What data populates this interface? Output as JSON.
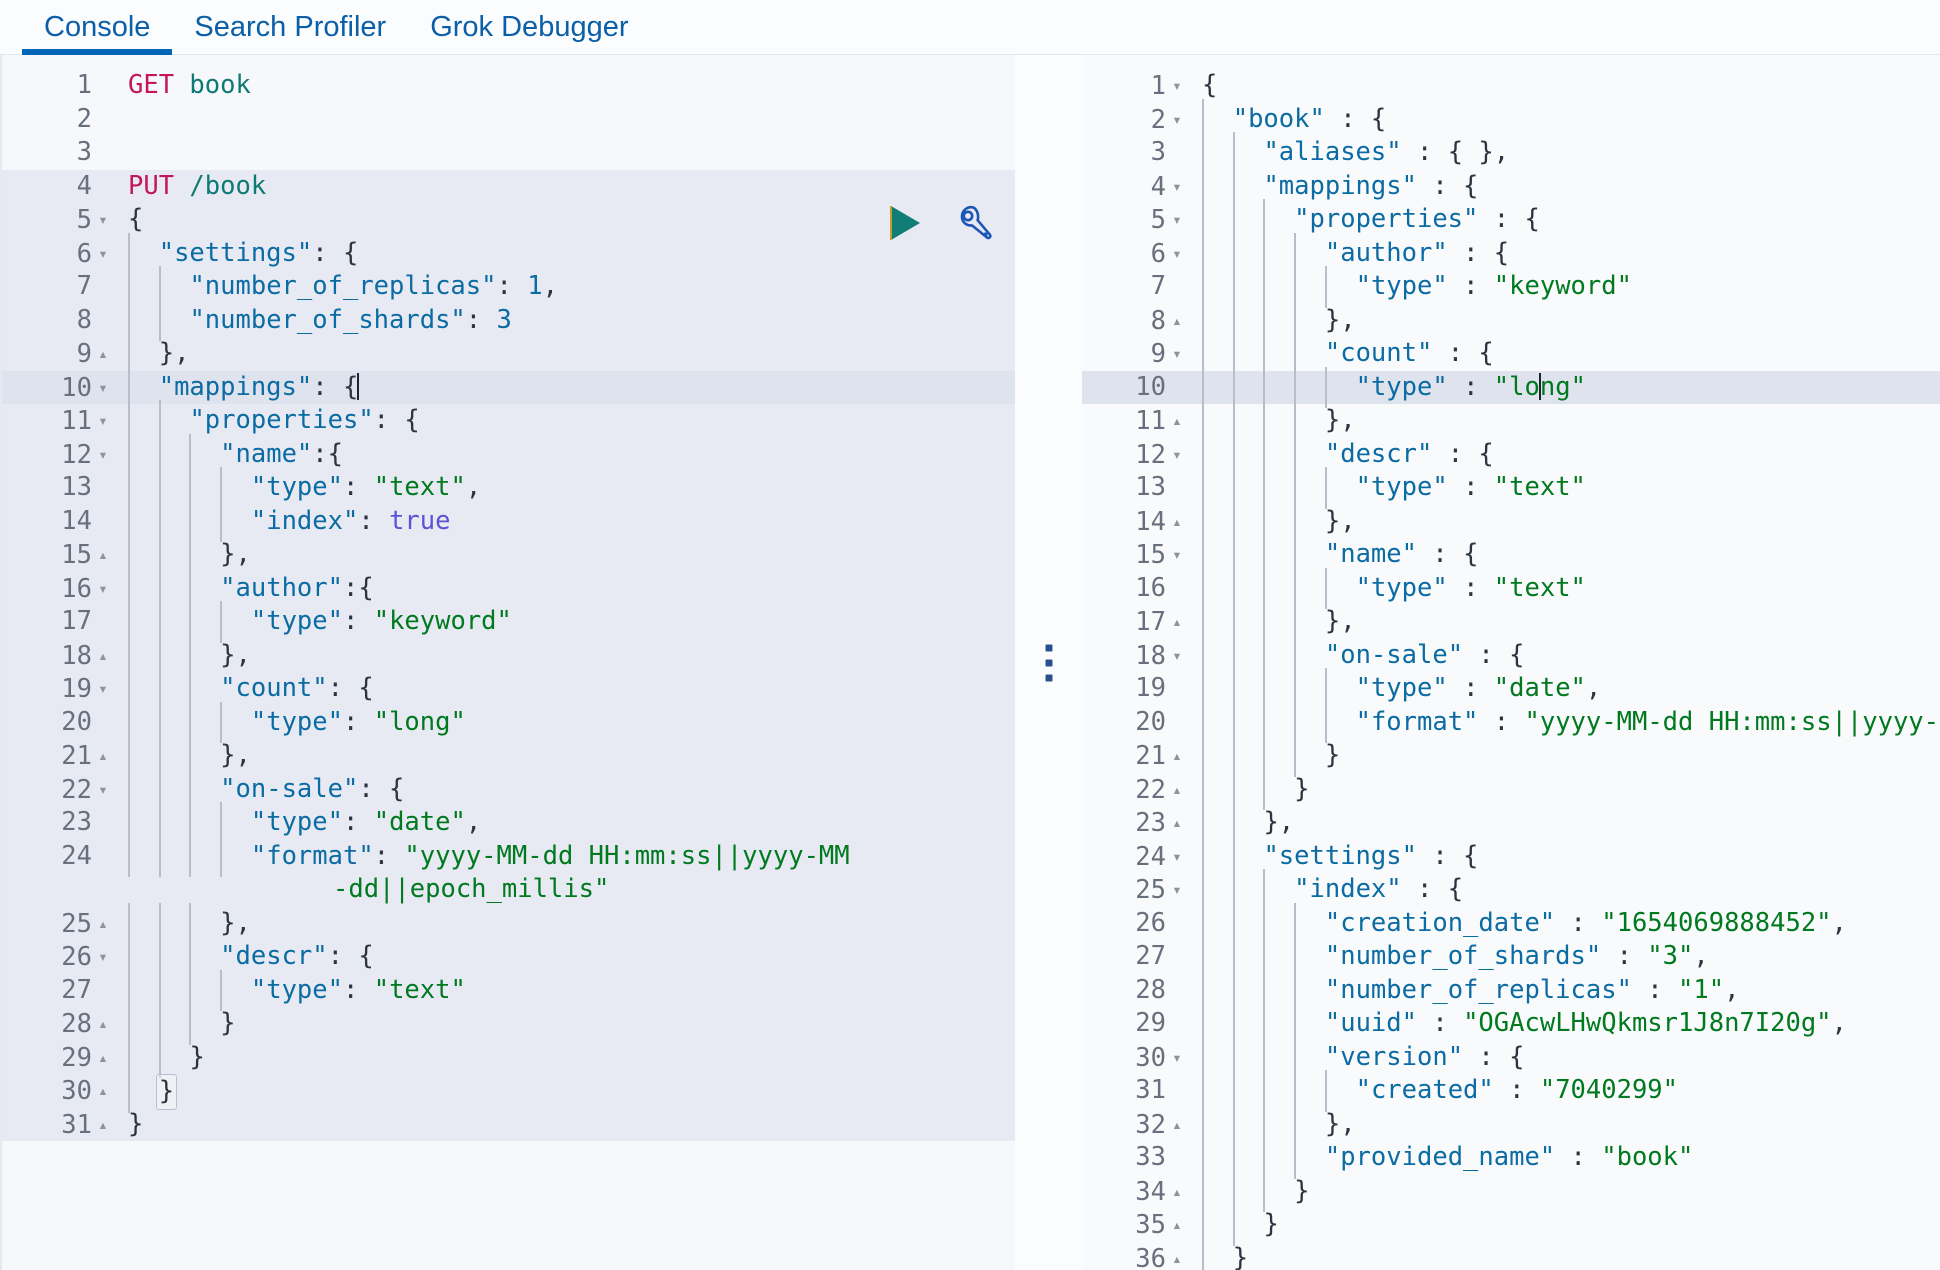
{
  "tabs": [
    {
      "label": "Console",
      "active": true
    },
    {
      "label": "Search Profiler",
      "active": false
    },
    {
      "label": "Grok Debugger",
      "active": false
    }
  ],
  "accent_color": "#0066b5",
  "tab_text_color": "#0a5fa8",
  "icons": {
    "play": {
      "name": "play-icon",
      "color": "#107e76",
      "title": "Click to send request"
    },
    "wrench": {
      "name": "wrench-icon",
      "color": "#1b56b5",
      "title": "Open documentation"
    },
    "drag_handle": {
      "name": "pane-drag-handle",
      "color": "#2a4f8f"
    }
  },
  "editor": {
    "name": "request-editor",
    "highlighted_line": 10,
    "selected_lines": [
      4,
      31
    ],
    "lines": [
      {
        "n": 1,
        "fold": "",
        "text": "GET book"
      },
      {
        "n": 2,
        "fold": "",
        "text": ""
      },
      {
        "n": 3,
        "fold": "",
        "text": ""
      },
      {
        "n": 4,
        "fold": "",
        "text": "PUT /book"
      },
      {
        "n": 5,
        "fold": "down",
        "text": "{"
      },
      {
        "n": 6,
        "fold": "down",
        "text": "  \"settings\": {"
      },
      {
        "n": 7,
        "fold": "",
        "text": "    \"number_of_replicas\": 1,"
      },
      {
        "n": 8,
        "fold": "",
        "text": "    \"number_of_shards\": 3"
      },
      {
        "n": 9,
        "fold": "up",
        "text": "  },"
      },
      {
        "n": 10,
        "fold": "down",
        "text": "  \"mappings\": {"
      },
      {
        "n": 11,
        "fold": "down",
        "text": "    \"properties\": {"
      },
      {
        "n": 12,
        "fold": "down",
        "text": "      \"name\":{"
      },
      {
        "n": 13,
        "fold": "",
        "text": "        \"type\": \"text\","
      },
      {
        "n": 14,
        "fold": "",
        "text": "        \"index\": true"
      },
      {
        "n": 15,
        "fold": "up",
        "text": "      },"
      },
      {
        "n": 16,
        "fold": "down",
        "text": "      \"author\":{"
      },
      {
        "n": 17,
        "fold": "",
        "text": "        \"type\": \"keyword\""
      },
      {
        "n": 18,
        "fold": "up",
        "text": "      },"
      },
      {
        "n": 19,
        "fold": "down",
        "text": "      \"count\": {"
      },
      {
        "n": 20,
        "fold": "",
        "text": "        \"type\": \"long\""
      },
      {
        "n": 21,
        "fold": "up",
        "text": "      },"
      },
      {
        "n": 22,
        "fold": "down",
        "text": "      \"on-sale\": {"
      },
      {
        "n": 23,
        "fold": "",
        "text": "        \"type\": \"date\","
      },
      {
        "n": 24,
        "fold": "",
        "text": "        \"format\": \"yyyy-MM-dd HH:mm:ss||yyyy-MM-dd||epoch_millis\""
      },
      {
        "n": 25,
        "fold": "up",
        "text": "      },"
      },
      {
        "n": 26,
        "fold": "down",
        "text": "      \"descr\": {"
      },
      {
        "n": 27,
        "fold": "",
        "text": "        \"type\": \"text\""
      },
      {
        "n": 28,
        "fold": "up",
        "text": "      }"
      },
      {
        "n": 29,
        "fold": "up",
        "text": "    }"
      },
      {
        "n": 30,
        "fold": "up",
        "text": "  }"
      },
      {
        "n": 31,
        "fold": "up",
        "text": "}"
      }
    ]
  },
  "response": {
    "name": "response-viewer",
    "highlighted_line": 10,
    "lines": [
      {
        "n": 1,
        "fold": "down",
        "text": "{"
      },
      {
        "n": 2,
        "fold": "down",
        "text": "  \"book\" : {"
      },
      {
        "n": 3,
        "fold": "",
        "text": "    \"aliases\" : { },"
      },
      {
        "n": 4,
        "fold": "down",
        "text": "    \"mappings\" : {"
      },
      {
        "n": 5,
        "fold": "down",
        "text": "      \"properties\" : {"
      },
      {
        "n": 6,
        "fold": "down",
        "text": "        \"author\" : {"
      },
      {
        "n": 7,
        "fold": "",
        "text": "          \"type\" : \"keyword\""
      },
      {
        "n": 8,
        "fold": "up",
        "text": "        },"
      },
      {
        "n": 9,
        "fold": "down",
        "text": "        \"count\" : {"
      },
      {
        "n": 10,
        "fold": "",
        "text": "          \"type\" : \"long\""
      },
      {
        "n": 11,
        "fold": "up",
        "text": "        },"
      },
      {
        "n": 12,
        "fold": "down",
        "text": "        \"descr\" : {"
      },
      {
        "n": 13,
        "fold": "",
        "text": "          \"type\" : \"text\""
      },
      {
        "n": 14,
        "fold": "up",
        "text": "        },"
      },
      {
        "n": 15,
        "fold": "down",
        "text": "        \"name\" : {"
      },
      {
        "n": 16,
        "fold": "",
        "text": "          \"type\" : \"text\""
      },
      {
        "n": 17,
        "fold": "up",
        "text": "        },"
      },
      {
        "n": 18,
        "fold": "down",
        "text": "        \"on-sale\" : {"
      },
      {
        "n": 19,
        "fold": "",
        "text": "          \"type\" : \"date\","
      },
      {
        "n": 20,
        "fold": "",
        "text": "          \"format\" : \"yyyy-MM-dd HH:mm:ss||yyyy-MM-dd||epoch_millis\""
      },
      {
        "n": 21,
        "fold": "up",
        "text": "        }"
      },
      {
        "n": 22,
        "fold": "up",
        "text": "      }"
      },
      {
        "n": 23,
        "fold": "up",
        "text": "    },"
      },
      {
        "n": 24,
        "fold": "down",
        "text": "    \"settings\" : {"
      },
      {
        "n": 25,
        "fold": "down",
        "text": "      \"index\" : {"
      },
      {
        "n": 26,
        "fold": "",
        "text": "        \"creation_date\" : \"1654069888452\","
      },
      {
        "n": 27,
        "fold": "",
        "text": "        \"number_of_shards\" : \"3\","
      },
      {
        "n": 28,
        "fold": "",
        "text": "        \"number_of_replicas\" : \"1\","
      },
      {
        "n": 29,
        "fold": "",
        "text": "        \"uuid\" : \"OGAcwLHwQkmsr1J8n7I20g\","
      },
      {
        "n": 30,
        "fold": "down",
        "text": "        \"version\" : {"
      },
      {
        "n": 31,
        "fold": "",
        "text": "          \"created\" : \"7040299\""
      },
      {
        "n": 32,
        "fold": "up",
        "text": "        },"
      },
      {
        "n": 33,
        "fold": "",
        "text": "        \"provided_name\" : \"book\""
      },
      {
        "n": 34,
        "fold": "up",
        "text": "      }"
      },
      {
        "n": 35,
        "fold": "up",
        "text": "    }"
      },
      {
        "n": 36,
        "fold": "up",
        "text": "  }"
      }
    ]
  }
}
